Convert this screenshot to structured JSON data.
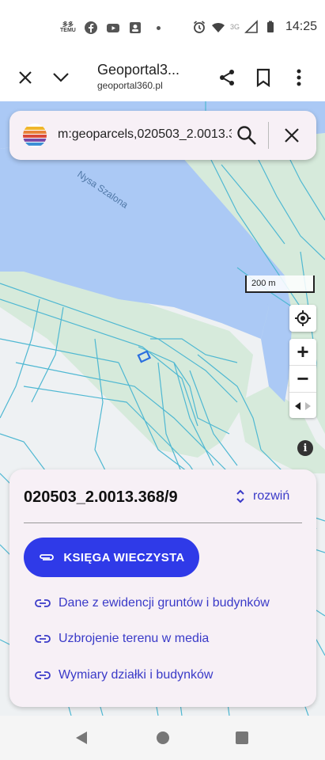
{
  "status_bar": {
    "time": "14:25",
    "network": "3G",
    "icons": [
      "temu-app-icon",
      "facebook-icon",
      "youtube-icon",
      "contacts-icon",
      "more-dot-icon",
      "alarm-icon",
      "wifi-icon",
      "signal-icon",
      "battery-icon"
    ],
    "temu_label_top": "多多",
    "temu_label_bottom": "TEMU"
  },
  "toolbar": {
    "title": "Geoportal3...",
    "subtitle": "geoportal360.pl",
    "icons": [
      "close-icon",
      "chevron-down-icon",
      "share-icon",
      "bookmark-icon",
      "more-vert-icon"
    ]
  },
  "search": {
    "query": "m:geoparcels,020503_2.0013.3"
  },
  "map": {
    "river_label": "Nysa Szalona",
    "scale_label": "200 m",
    "colors": {
      "water": "#abc9f5",
      "forest": "#d6eadb",
      "land": "#eef1f3",
      "parcel": "#4fb8d2",
      "selected": "#2a6fe0"
    }
  },
  "map_controls": {
    "zoom_in": "+",
    "zoom_out": "−",
    "info": "i"
  },
  "card": {
    "parcel_id": "020503_2.0013.368/9",
    "expand_label": "rozwiń",
    "primary_button": "KSIĘGA WIECZYSTA",
    "links": [
      "Dane z ewidencji gruntów i budynków",
      "Uzbrojenie terenu w media",
      "Wymiary działki i budynków"
    ],
    "accent_color": "#2f3ae8"
  }
}
